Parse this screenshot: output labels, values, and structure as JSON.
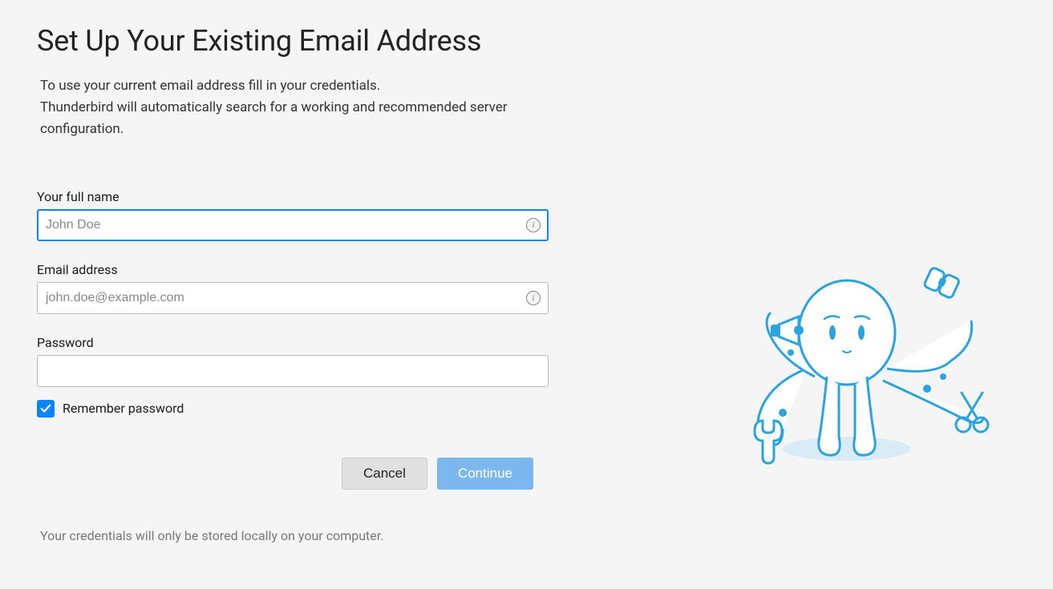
{
  "page": {
    "title": "Set Up Your Existing Email Address",
    "description_line1": "To use your current email address fill in your credentials.",
    "description_line2": "Thunderbird will automatically search for a working and recommended server configuration."
  },
  "form": {
    "name": {
      "label": "Your full name",
      "placeholder": "John Doe",
      "value": ""
    },
    "email": {
      "label": "Email address",
      "placeholder": "john.doe@example.com",
      "value": ""
    },
    "password": {
      "label": "Password",
      "placeholder": "",
      "value": ""
    },
    "remember": {
      "label": "Remember password",
      "checked": true
    }
  },
  "buttons": {
    "cancel": "Cancel",
    "continue": "Continue"
  },
  "footer": {
    "note": "Your credentials will only be stored locally on your computer."
  },
  "icons": {
    "info": "i"
  }
}
